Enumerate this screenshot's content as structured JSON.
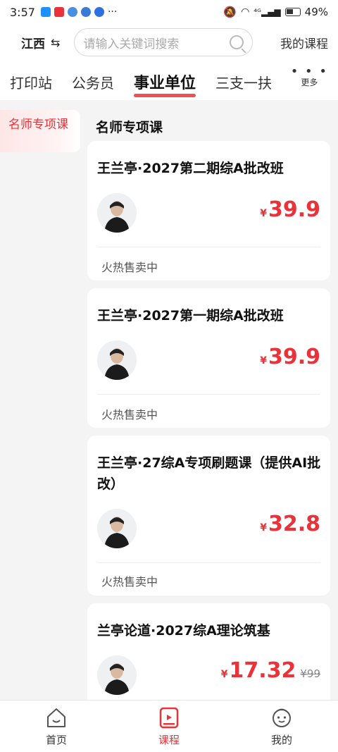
{
  "status_bar": {
    "time": "3:57",
    "network": "⁴ᴳ",
    "battery": "49%"
  },
  "header": {
    "region": "江西",
    "swap_icon": "⇆",
    "search_placeholder": "请输入关键词搜索",
    "my_courses": "我的课程"
  },
  "tabs": [
    {
      "label": "打印站"
    },
    {
      "label": "公务员"
    },
    {
      "label": "事业单位",
      "active": true
    },
    {
      "label": "三支一扶"
    }
  ],
  "more_label": "更多",
  "sidebar": {
    "items": [
      {
        "label": "名师专项课",
        "active": true
      }
    ]
  },
  "section_title": "名师专项课",
  "courses": [
    {
      "title": "王兰亭·2027第二期综A批改班",
      "price": "39.9",
      "status": "火热售卖中"
    },
    {
      "title": "王兰亭·2027第一期综A批改班",
      "price": "39.9",
      "status": "火热售卖中"
    },
    {
      "title": "王兰亭·27综A专项刷题课（提供AI批改）",
      "price": "32.8",
      "status": "火热售卖中"
    },
    {
      "title": "兰亭论道·2027综A理论筑基",
      "price": "17.32",
      "original_price": "¥99"
    }
  ],
  "currency": "¥",
  "bottom_nav": [
    {
      "label": "首页",
      "icon": "home-icon"
    },
    {
      "label": "课程",
      "icon": "course-icon",
      "active": true
    },
    {
      "label": "我的",
      "icon": "profile-icon"
    }
  ],
  "colors": {
    "accent": "#e8333a",
    "background": "#f4f4f4"
  }
}
